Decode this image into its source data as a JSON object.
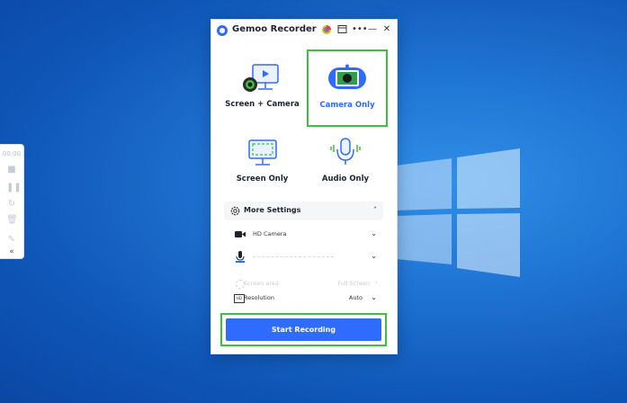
{
  "app": {
    "title": "Gemoo Recorder",
    "accent": "#2f6bff",
    "highlight": "#3fbf3f",
    "title_icons": [
      "browser-icon",
      "calendar-icon",
      "more-icon",
      "minimize-icon",
      "close-icon"
    ]
  },
  "modes": [
    {
      "label": "Screen + Camera",
      "icon": "screen-camera-icon"
    },
    {
      "label": "Camera Only",
      "icon": "camera-icon",
      "selected": true
    },
    {
      "label": "Screen Only",
      "icon": "screen-icon"
    },
    {
      "label": "Audio Only",
      "icon": "microphone-icon"
    }
  ],
  "settings": {
    "header": "More Settings",
    "camera": "HD Camera",
    "screen_area_label": "Screen area",
    "screen_area_value": "Full Screen",
    "resolution_label": "Resolution",
    "resolution_value": "Auto"
  },
  "start_button": "Start Recording",
  "toolbar": {
    "timer": "00:00"
  }
}
